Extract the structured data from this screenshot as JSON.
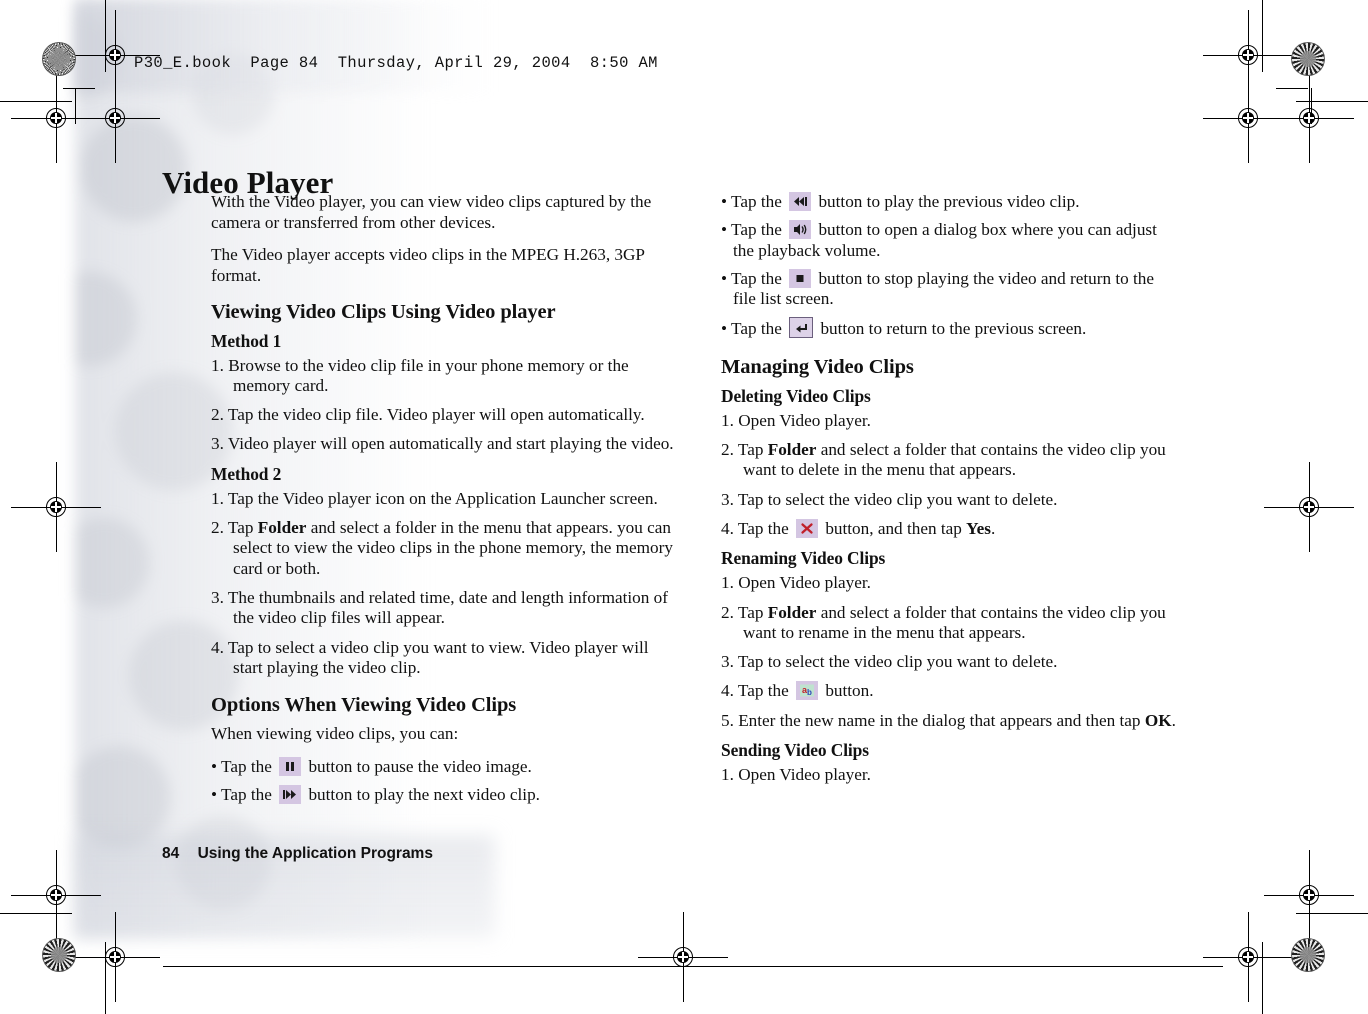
{
  "print_header": "P30_E.book  Page 84  Thursday, April 29, 2004  8:50 AM",
  "page_title": "Video Player",
  "footer": {
    "page_number": "84",
    "section": "Using the Application Programs"
  },
  "colors": {
    "chip_background": "#d4c6e2",
    "chip_border": "#6b5f7d",
    "delete_icon": "#c0202a",
    "text": "#111111",
    "page_background": "#ffffff"
  },
  "left_column": {
    "intro_paragraphs": [
      "With the Video player, you can view video clips captured by the camera or transferred from other devices.",
      "The Video player accepts video clips in the MPEG H.263, 3GP format."
    ],
    "section_viewing": {
      "heading": "Viewing Video Clips Using Video player",
      "method1_heading": "Method 1",
      "method1_steps": [
        {
          "num": "1.",
          "text": "Browse to the video clip file in your phone memory or the memory card."
        },
        {
          "num": "2.",
          "text": "Tap the video clip file. Video player will open automatically."
        },
        {
          "num": "3.",
          "text": "Video player will open automatically and start playing the video."
        }
      ],
      "method2_heading": "Method 2",
      "method2_steps": [
        {
          "num": "1.",
          "text": "Tap the Video player icon on the Application Launcher screen."
        },
        {
          "num": "2.",
          "pre": "Tap ",
          "bold": "Folder",
          "post": " and select a folder in the menu that appears. you can select to view the video clips in the phone memory, the memory card or both."
        },
        {
          "num": "3.",
          "text": "The thumbnails and related time, date and length information of the video clip files will appear."
        },
        {
          "num": "4.",
          "text": "Tap to select a video clip you want to view. Video player will start playing the video clip."
        }
      ]
    },
    "section_options": {
      "heading": "Options When Viewing Video Clips",
      "intro": "When viewing video clips, you can:",
      "bullets": [
        {
          "marker": "•",
          "pre": "Tap the ",
          "icon": "pause-icon",
          "post": " button to pause the video image."
        },
        {
          "marker": "•",
          "pre": "Tap the ",
          "icon": "next-clip-icon",
          "post": " button to play the next video clip."
        }
      ]
    }
  },
  "right_column": {
    "option_bullets": [
      {
        "marker": "•",
        "pre": "Tap the ",
        "icon": "previous-clip-icon",
        "post": " button to play the previous video clip."
      },
      {
        "marker": "•",
        "pre": "Tap the ",
        "icon": "volume-icon",
        "post": " button to open a dialog box where you can adjust the playback volume."
      },
      {
        "marker": "•",
        "pre": "Tap the ",
        "icon": "stop-icon",
        "post": " button to stop playing the video and return to the file list screen."
      },
      {
        "marker": "•",
        "pre": "Tap the ",
        "icon": "return-icon",
        "post": " button to return to the previous screen."
      }
    ],
    "section_managing": {
      "heading": "Managing Video Clips",
      "deleting": {
        "heading": "Deleting Video Clips",
        "steps": [
          {
            "num": "1.",
            "text": "Open Video player."
          },
          {
            "num": "2.",
            "pre": "Tap ",
            "bold": "Folder",
            "post": " and select a folder that contains the video clip you want to delete in the menu that appears."
          },
          {
            "num": "3.",
            "text": "Tap to select the video clip you want to delete."
          },
          {
            "num": "4.",
            "pre": "Tap the ",
            "icon": "delete-icon",
            "mid": " button, and then tap ",
            "bold": "Yes",
            "post": "."
          }
        ]
      },
      "renaming": {
        "heading": "Renaming Video Clips",
        "steps": [
          {
            "num": "1.",
            "text": "Open Video player."
          },
          {
            "num": "2.",
            "pre": "Tap ",
            "bold": "Folder",
            "post": " and select a folder that contains the video clip you want to rename in the menu that appears."
          },
          {
            "num": "3.",
            "text": "Tap to select the video clip you want to delete."
          },
          {
            "num": "4.",
            "pre": "Tap the ",
            "icon": "rename-icon",
            "post": " button."
          },
          {
            "num": "5.",
            "pre": "Enter the new name in the dialog that appears and then tap ",
            "bold": "OK",
            "post": "."
          }
        ]
      },
      "sending": {
        "heading": "Sending Video Clips",
        "steps": [
          {
            "num": "1.",
            "text": "Open Video player."
          }
        ]
      }
    }
  }
}
